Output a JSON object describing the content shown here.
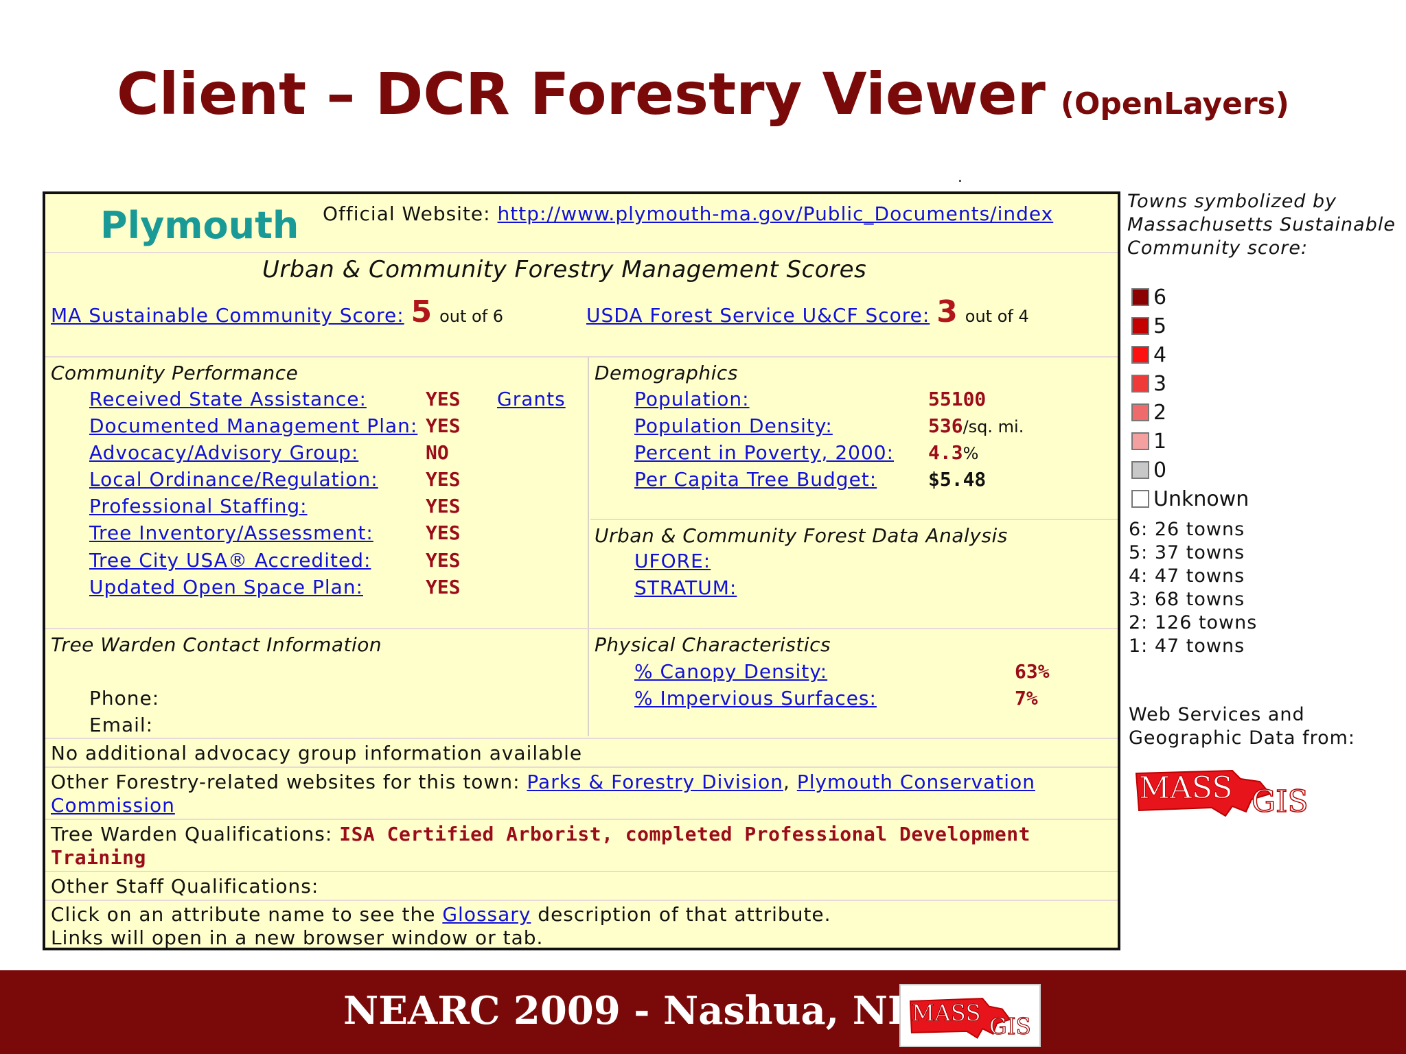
{
  "slide": {
    "title": "Client – DCR Forestry Viewer",
    "subtitle": "(OpenLayers)"
  },
  "panel": {
    "town": "Plymouth",
    "website_label": "Official Website:",
    "website_url": "http://www.plymouth-ma.gov/Public_Documents/index",
    "scores_heading": "Urban & Community Forestry Management Scores",
    "ma_score_label": "MA Sustainable Community Score:",
    "ma_score_value": "5",
    "ma_score_outof": "out of 6",
    "usda_score_label": "USDA Forest Service U&CF Score:",
    "usda_score_value": "3",
    "usda_score_outof": "out of 4",
    "community_performance": {
      "heading": "Community Performance",
      "grants_link": "Grants",
      "rows": [
        {
          "label": "Received State Assistance:",
          "value": "YES"
        },
        {
          "label": "Documented Management Plan:",
          "value": "YES"
        },
        {
          "label": "Advocacy/Advisory Group:",
          "value": "NO"
        },
        {
          "label": "Local Ordinance/Regulation:",
          "value": "YES"
        },
        {
          "label": "Professional Staffing:",
          "value": "YES"
        },
        {
          "label": "Tree Inventory/Assessment:",
          "value": "YES"
        },
        {
          "label": "Tree City USA® Accredited:",
          "value": "YES"
        },
        {
          "label": "Updated Open Space Plan:",
          "value": "YES"
        }
      ]
    },
    "demographics": {
      "heading": "Demographics",
      "rows": [
        {
          "label": "Population:",
          "value": "55100",
          "unit": ""
        },
        {
          "label": "Population Density:",
          "value": "536",
          "unit": "/sq. mi."
        },
        {
          "label": "Percent in Poverty, 2000:",
          "value": "4.3",
          "unit": "%"
        },
        {
          "label": "Per Capita Tree Budget:",
          "value": "$5.48",
          "unit": ""
        }
      ]
    },
    "data_analysis": {
      "heading": "Urban & Community Forest Data Analysis",
      "links": [
        "UFORE:",
        "STRATUM:"
      ]
    },
    "tree_warden": {
      "heading": "Tree Warden Contact Information",
      "phone_label": "Phone:",
      "email_label": "Email:"
    },
    "physical": {
      "heading": "Physical Characteristics",
      "rows": [
        {
          "label": "% Canopy Density:",
          "value": "63",
          "unit": "%"
        },
        {
          "label": "% Impervious Surfaces:",
          "value": "7",
          "unit": "%"
        }
      ]
    },
    "advocacy_note": "No additional advocacy group information available",
    "other_sites_prefix": "Other Forestry-related websites for this town:",
    "other_sites_link1": "Parks & Forestry Division",
    "other_sites_sep": ",",
    "other_sites_link2_a": "Plymouth Conservation",
    "other_sites_link2_b": "Commission",
    "warden_qual_label": "Tree Warden Qualifications:",
    "warden_qual_value_a": "ISA Certified Arborist, completed Professional Development",
    "warden_qual_value_b": "Training",
    "staff_qual_label": "Other Staff Qualifications:",
    "glossary_pre": "Click on an attribute name to see the",
    "glossary_link": "Glossary",
    "glossary_post": "description of that attribute.",
    "links_note": "Links will open in a new browser window or tab."
  },
  "legend": {
    "heading_lines": [
      "Towns symbolized by",
      "Massachusetts Sustainable",
      "Community score:"
    ],
    "items": [
      {
        "label": "6",
        "color": "#8b0000"
      },
      {
        "label": "5",
        "color": "#c40000"
      },
      {
        "label": "4",
        "color": "#ff1010"
      },
      {
        "label": "3",
        "color": "#f03a3a"
      },
      {
        "label": "2",
        "color": "#ef6a6a"
      },
      {
        "label": "1",
        "color": "#f5a0a0"
      },
      {
        "label": "0",
        "color": "#c8c8c8"
      },
      {
        "label": "Unknown",
        "color": "#ffffff"
      }
    ],
    "counts": [
      "6: 26 towns",
      "5: 37 towns",
      "4: 47 towns",
      "3: 68 towns",
      "2: 126 towns",
      "1: 47 towns"
    ],
    "credit_lines": [
      "Web Services and",
      "Geographic Data from:"
    ],
    "logo_text_a": "MASS",
    "logo_text_b": "GIS",
    "logo_color": "#e8141c"
  },
  "footer": {
    "text": "NEARC  2009 -  Nashua, NH",
    "logo_text_a": "MASS",
    "logo_text_b": "GIS"
  }
}
